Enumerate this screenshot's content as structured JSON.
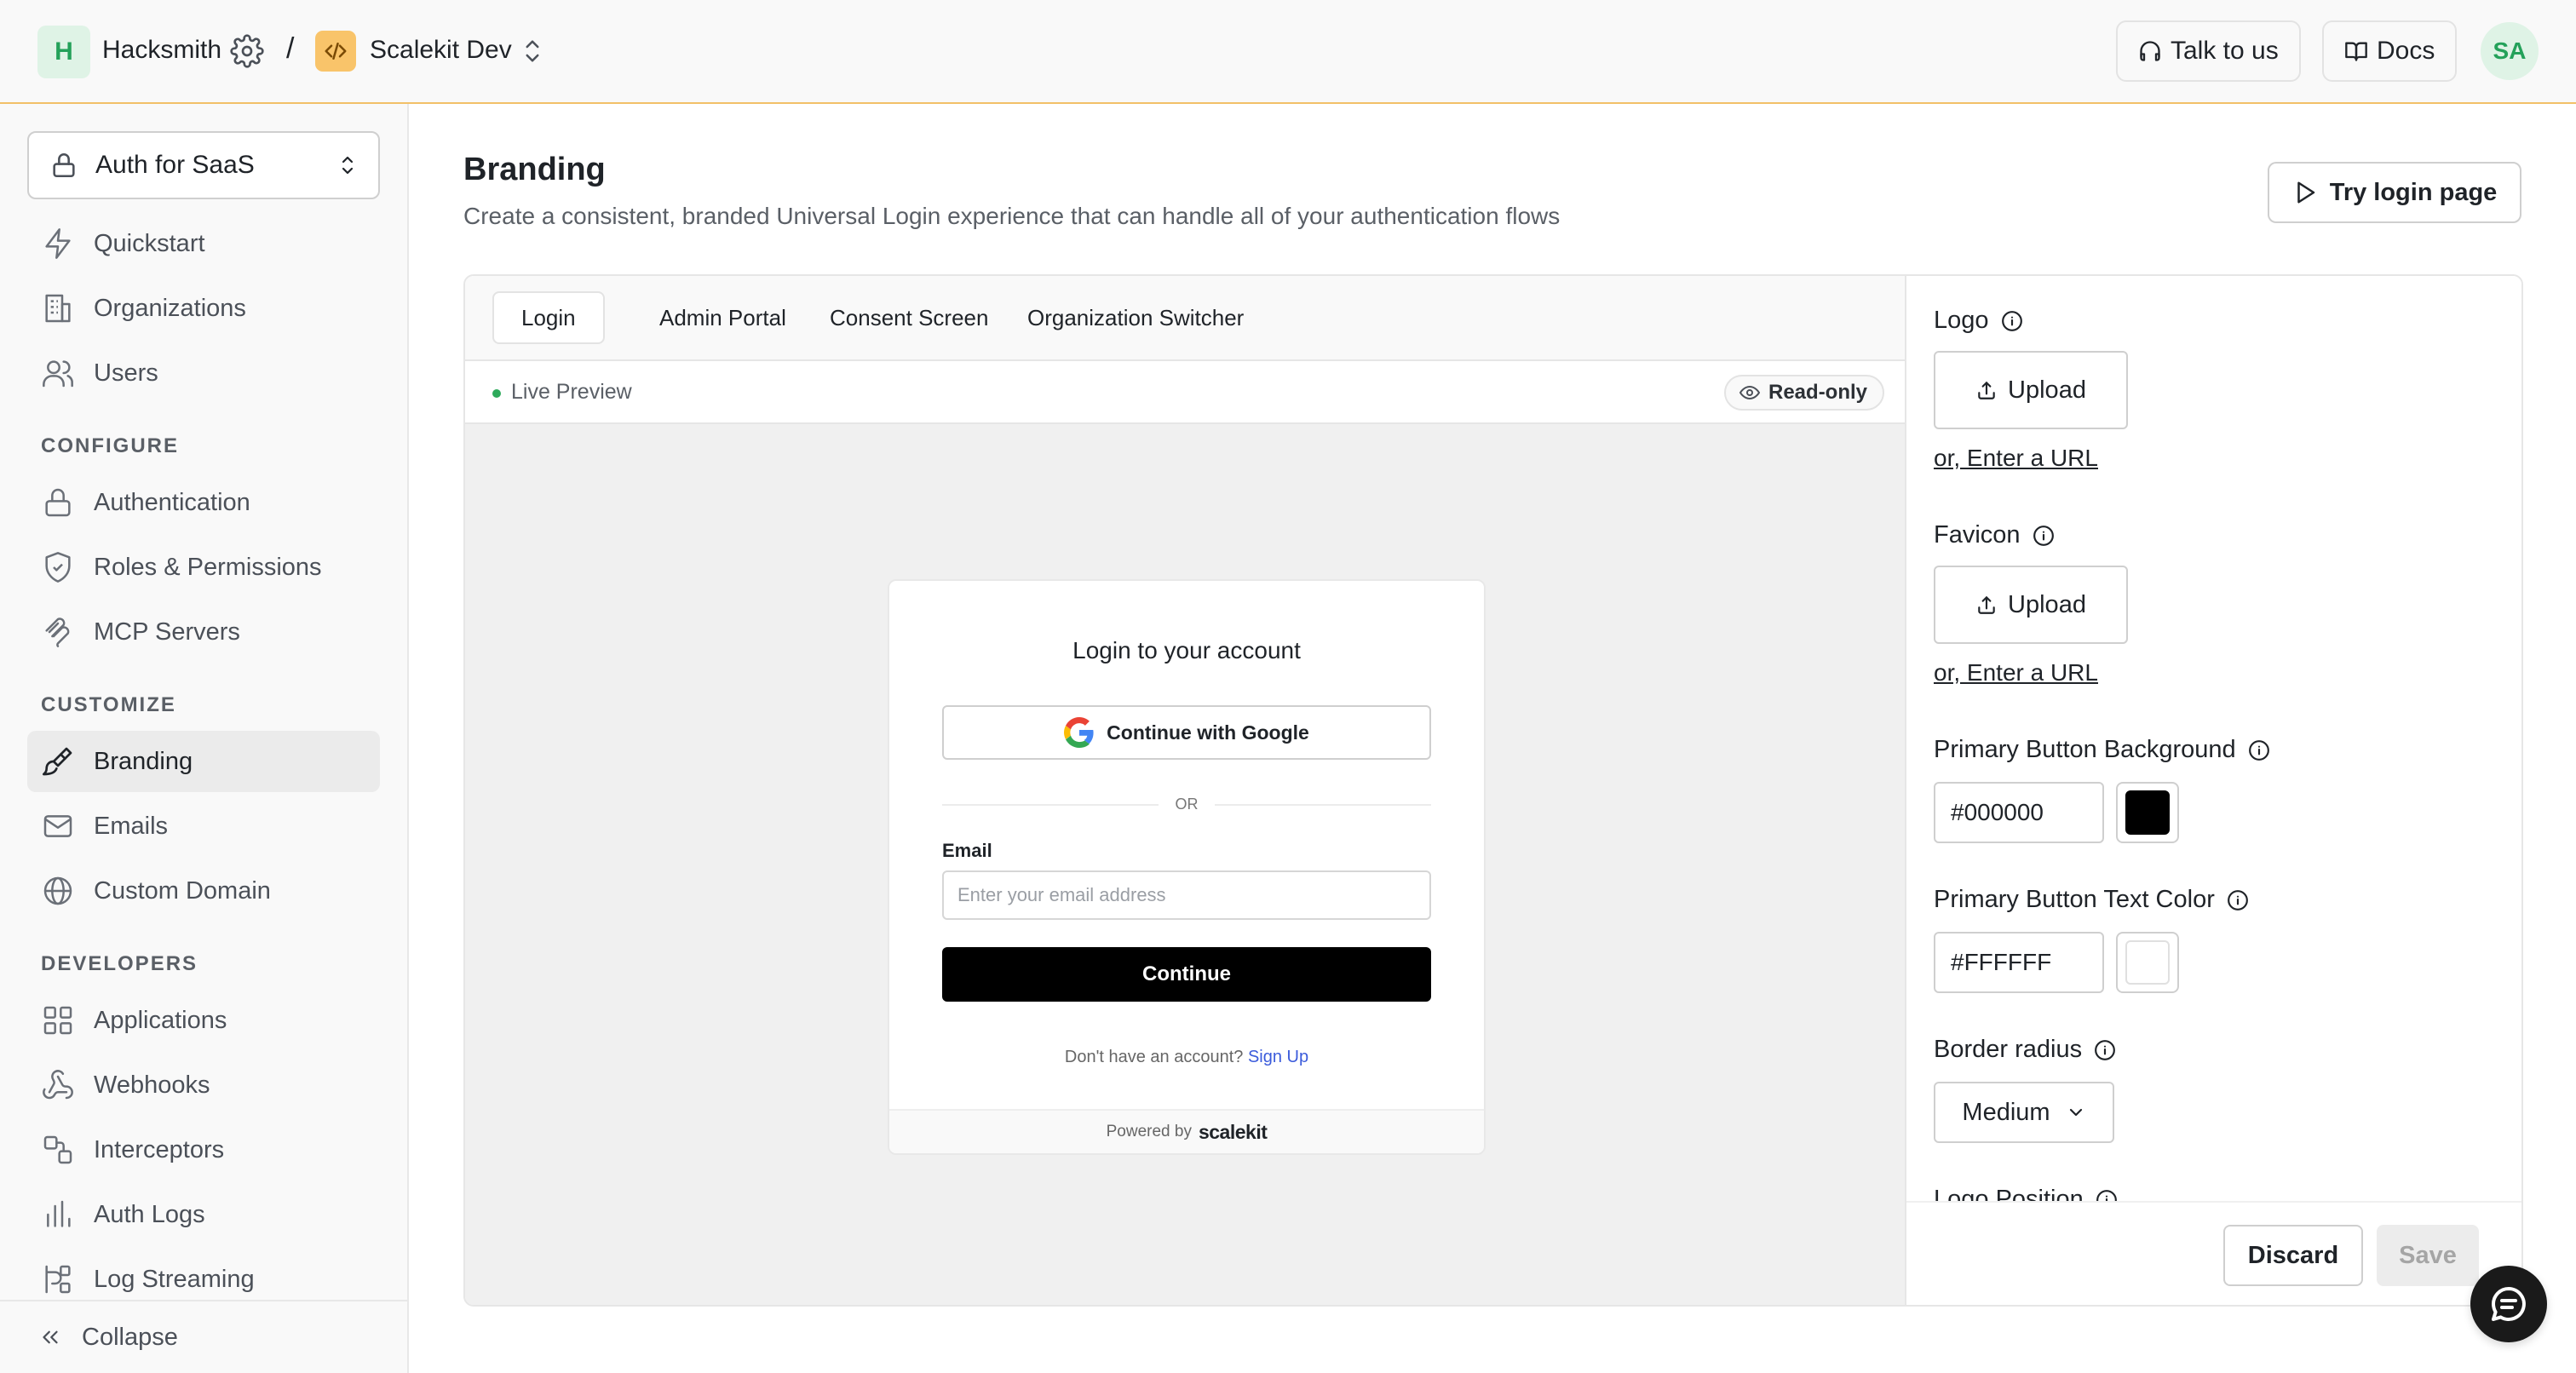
{
  "topbar": {
    "workspace_initial": "H",
    "workspace_name": "Hacksmith",
    "separator": "/",
    "environment_name": "Scalekit Dev",
    "talk_label": "Talk to us",
    "docs_label": "Docs",
    "user_initials": "SA",
    "accent_color": "#f2c068"
  },
  "sidebar": {
    "app_select": "Auth for SaaS",
    "items_top": [
      {
        "label": "Quickstart",
        "icon": "bolt-icon"
      },
      {
        "label": "Organizations",
        "icon": "building-icon"
      },
      {
        "label": "Users",
        "icon": "users-icon"
      }
    ],
    "configure_label": "CONFIGURE",
    "items_configure": [
      {
        "label": "Authentication",
        "icon": "lock-icon"
      },
      {
        "label": "Roles & Permissions",
        "icon": "shield-icon"
      },
      {
        "label": "MCP Servers",
        "icon": "mcp-icon"
      }
    ],
    "customize_label": "CUSTOMIZE",
    "items_customize": [
      {
        "label": "Branding",
        "icon": "paintbrush-icon",
        "active": true
      },
      {
        "label": "Emails",
        "icon": "mail-icon"
      },
      {
        "label": "Custom Domain",
        "icon": "globe-icon"
      }
    ],
    "developers_label": "DEVELOPERS",
    "items_developers": [
      {
        "label": "Applications",
        "icon": "grid-icon"
      },
      {
        "label": "Webhooks",
        "icon": "webhook-icon"
      },
      {
        "label": "Interceptors",
        "icon": "interceptor-icon"
      },
      {
        "label": "Auth Logs",
        "icon": "bar-chart-icon"
      },
      {
        "label": "Log Streaming",
        "icon": "stream-icon"
      }
    ],
    "collapse_label": "Collapse"
  },
  "page": {
    "title": "Branding",
    "subtitle": "Create a consistent, branded Universal Login experience that can handle all of your authentication flows",
    "try_login_label": "Try login page"
  },
  "tabs": [
    "Login",
    "Admin Portal",
    "Consent Screen",
    "Organization Switcher"
  ],
  "active_tab": "Login",
  "preview": {
    "live_label": "Live Preview",
    "readonly_label": "Read-only"
  },
  "login_card": {
    "title": "Login to your account",
    "google_label": "Continue with Google",
    "or_label": "OR",
    "email_label": "Email",
    "email_placeholder": "Enter your email address",
    "continue_label": "Continue",
    "no_account_text": "Don't have an account?",
    "signup_label": "Sign Up",
    "powered_by": "Powered by",
    "brand": "scalekit"
  },
  "settings": {
    "logo_label": "Logo",
    "logo_upload": "Upload",
    "logo_url_link": "or, Enter a URL",
    "favicon_label": "Favicon",
    "favicon_upload": "Upload",
    "favicon_url_link": "or, Enter a URL",
    "primary_bg_label": "Primary Button Background",
    "primary_bg_value": "#000000",
    "primary_text_label": "Primary Button Text Color",
    "primary_text_value": "#FFFFFF",
    "border_radius_label": "Border radius",
    "border_radius_value": "Medium",
    "logo_position_label": "Logo Position",
    "discard_label": "Discard",
    "save_label": "Save"
  }
}
